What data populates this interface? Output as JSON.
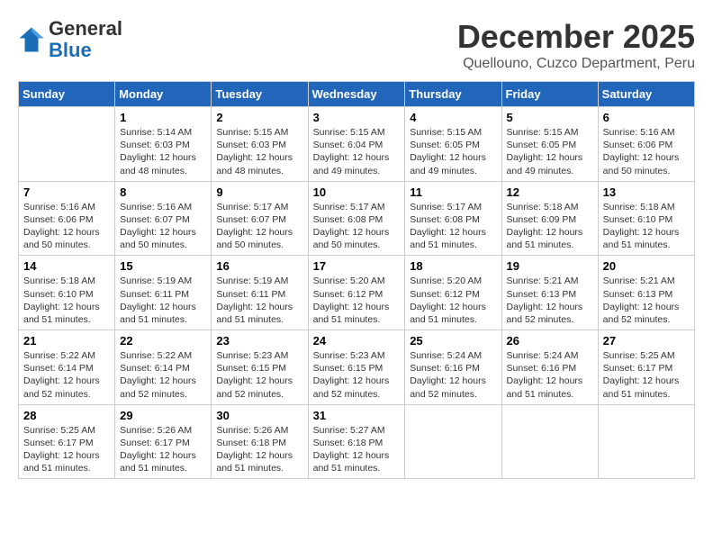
{
  "logo": {
    "general": "General",
    "blue": "Blue"
  },
  "header": {
    "month_title": "December 2025",
    "subtitle": "Quellouno, Cuzco Department, Peru"
  },
  "days_of_week": [
    "Sunday",
    "Monday",
    "Tuesday",
    "Wednesday",
    "Thursday",
    "Friday",
    "Saturday"
  ],
  "weeks": [
    [
      {
        "day": "",
        "info": ""
      },
      {
        "day": "1",
        "info": "Sunrise: 5:14 AM\nSunset: 6:03 PM\nDaylight: 12 hours\nand 48 minutes."
      },
      {
        "day": "2",
        "info": "Sunrise: 5:15 AM\nSunset: 6:03 PM\nDaylight: 12 hours\nand 48 minutes."
      },
      {
        "day": "3",
        "info": "Sunrise: 5:15 AM\nSunset: 6:04 PM\nDaylight: 12 hours\nand 49 minutes."
      },
      {
        "day": "4",
        "info": "Sunrise: 5:15 AM\nSunset: 6:05 PM\nDaylight: 12 hours\nand 49 minutes."
      },
      {
        "day": "5",
        "info": "Sunrise: 5:15 AM\nSunset: 6:05 PM\nDaylight: 12 hours\nand 49 minutes."
      },
      {
        "day": "6",
        "info": "Sunrise: 5:16 AM\nSunset: 6:06 PM\nDaylight: 12 hours\nand 50 minutes."
      }
    ],
    [
      {
        "day": "7",
        "info": "Sunrise: 5:16 AM\nSunset: 6:06 PM\nDaylight: 12 hours\nand 50 minutes."
      },
      {
        "day": "8",
        "info": "Sunrise: 5:16 AM\nSunset: 6:07 PM\nDaylight: 12 hours\nand 50 minutes."
      },
      {
        "day": "9",
        "info": "Sunrise: 5:17 AM\nSunset: 6:07 PM\nDaylight: 12 hours\nand 50 minutes."
      },
      {
        "day": "10",
        "info": "Sunrise: 5:17 AM\nSunset: 6:08 PM\nDaylight: 12 hours\nand 50 minutes."
      },
      {
        "day": "11",
        "info": "Sunrise: 5:17 AM\nSunset: 6:08 PM\nDaylight: 12 hours\nand 51 minutes."
      },
      {
        "day": "12",
        "info": "Sunrise: 5:18 AM\nSunset: 6:09 PM\nDaylight: 12 hours\nand 51 minutes."
      },
      {
        "day": "13",
        "info": "Sunrise: 5:18 AM\nSunset: 6:10 PM\nDaylight: 12 hours\nand 51 minutes."
      }
    ],
    [
      {
        "day": "14",
        "info": "Sunrise: 5:18 AM\nSunset: 6:10 PM\nDaylight: 12 hours\nand 51 minutes."
      },
      {
        "day": "15",
        "info": "Sunrise: 5:19 AM\nSunset: 6:11 PM\nDaylight: 12 hours\nand 51 minutes."
      },
      {
        "day": "16",
        "info": "Sunrise: 5:19 AM\nSunset: 6:11 PM\nDaylight: 12 hours\nand 51 minutes."
      },
      {
        "day": "17",
        "info": "Sunrise: 5:20 AM\nSunset: 6:12 PM\nDaylight: 12 hours\nand 51 minutes."
      },
      {
        "day": "18",
        "info": "Sunrise: 5:20 AM\nSunset: 6:12 PM\nDaylight: 12 hours\nand 51 minutes."
      },
      {
        "day": "19",
        "info": "Sunrise: 5:21 AM\nSunset: 6:13 PM\nDaylight: 12 hours\nand 52 minutes."
      },
      {
        "day": "20",
        "info": "Sunrise: 5:21 AM\nSunset: 6:13 PM\nDaylight: 12 hours\nand 52 minutes."
      }
    ],
    [
      {
        "day": "21",
        "info": "Sunrise: 5:22 AM\nSunset: 6:14 PM\nDaylight: 12 hours\nand 52 minutes."
      },
      {
        "day": "22",
        "info": "Sunrise: 5:22 AM\nSunset: 6:14 PM\nDaylight: 12 hours\nand 52 minutes."
      },
      {
        "day": "23",
        "info": "Sunrise: 5:23 AM\nSunset: 6:15 PM\nDaylight: 12 hours\nand 52 minutes."
      },
      {
        "day": "24",
        "info": "Sunrise: 5:23 AM\nSunset: 6:15 PM\nDaylight: 12 hours\nand 52 minutes."
      },
      {
        "day": "25",
        "info": "Sunrise: 5:24 AM\nSunset: 6:16 PM\nDaylight: 12 hours\nand 52 minutes."
      },
      {
        "day": "26",
        "info": "Sunrise: 5:24 AM\nSunset: 6:16 PM\nDaylight: 12 hours\nand 51 minutes."
      },
      {
        "day": "27",
        "info": "Sunrise: 5:25 AM\nSunset: 6:17 PM\nDaylight: 12 hours\nand 51 minutes."
      }
    ],
    [
      {
        "day": "28",
        "info": "Sunrise: 5:25 AM\nSunset: 6:17 PM\nDaylight: 12 hours\nand 51 minutes."
      },
      {
        "day": "29",
        "info": "Sunrise: 5:26 AM\nSunset: 6:17 PM\nDaylight: 12 hours\nand 51 minutes."
      },
      {
        "day": "30",
        "info": "Sunrise: 5:26 AM\nSunset: 6:18 PM\nDaylight: 12 hours\nand 51 minutes."
      },
      {
        "day": "31",
        "info": "Sunrise: 5:27 AM\nSunset: 6:18 PM\nDaylight: 12 hours\nand 51 minutes."
      },
      {
        "day": "",
        "info": ""
      },
      {
        "day": "",
        "info": ""
      },
      {
        "day": "",
        "info": ""
      }
    ]
  ]
}
